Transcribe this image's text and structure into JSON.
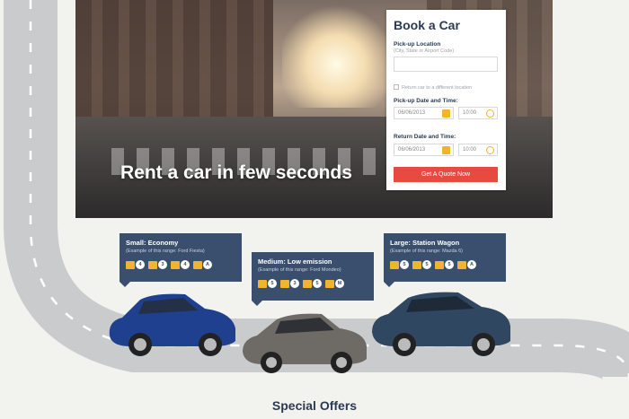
{
  "hero": {
    "headline": "Rent a car in few seconds"
  },
  "booking": {
    "title": "Book a Car",
    "pickup_label": "Pick-up Location",
    "pickup_hint": "(City, State or Airport Code)",
    "pickup_value": "",
    "return_checkbox_label": "Return car to a different location",
    "pickup_datetime_label": "Pick-up Date and Time:",
    "pickup_date": "06/06/2013",
    "pickup_time": "10:00",
    "return_datetime_label": "Return Date and Time:",
    "return_date": "06/06/2013",
    "return_time": "10:00",
    "quote_button": "Get A Quote Now",
    "accent": "#e84a3f"
  },
  "cars": [
    {
      "title": "Small: Economy",
      "example": "(Example of this range: Ford Fiesta)",
      "features": [
        {
          "icon": "seats-icon",
          "value": "4"
        },
        {
          "icon": "large-bag-icon",
          "value": "3"
        },
        {
          "icon": "small-bag-icon",
          "value": "4"
        },
        {
          "icon": "transmission-icon",
          "value": "A"
        }
      ],
      "color": "#1f3f8f"
    },
    {
      "title": "Medium: Low emission",
      "example": "(Example of this range: Ford Mondeo)",
      "features": [
        {
          "icon": "seats-icon",
          "value": "5"
        },
        {
          "icon": "large-bag-icon",
          "value": "3"
        },
        {
          "icon": "small-bag-icon",
          "value": "5"
        },
        {
          "icon": "transmission-icon",
          "value": "M"
        }
      ],
      "color": "#6e6a66"
    },
    {
      "title": "Large: Station Wagon",
      "example": "(Example of this range: Mazda 6)",
      "features": [
        {
          "icon": "seats-icon",
          "value": "5"
        },
        {
          "icon": "large-bag-icon",
          "value": "5"
        },
        {
          "icon": "small-bag-icon",
          "value": "5"
        },
        {
          "icon": "transmission-icon",
          "value": "A"
        }
      ],
      "color": "#2f4760"
    }
  ],
  "sections": {
    "special_offers": "Special Offers"
  },
  "colors": {
    "navy": "#3a4f6e",
    "yellow": "#f0b52d",
    "road": "#c9cbcd",
    "background": "#f2f2ef"
  }
}
